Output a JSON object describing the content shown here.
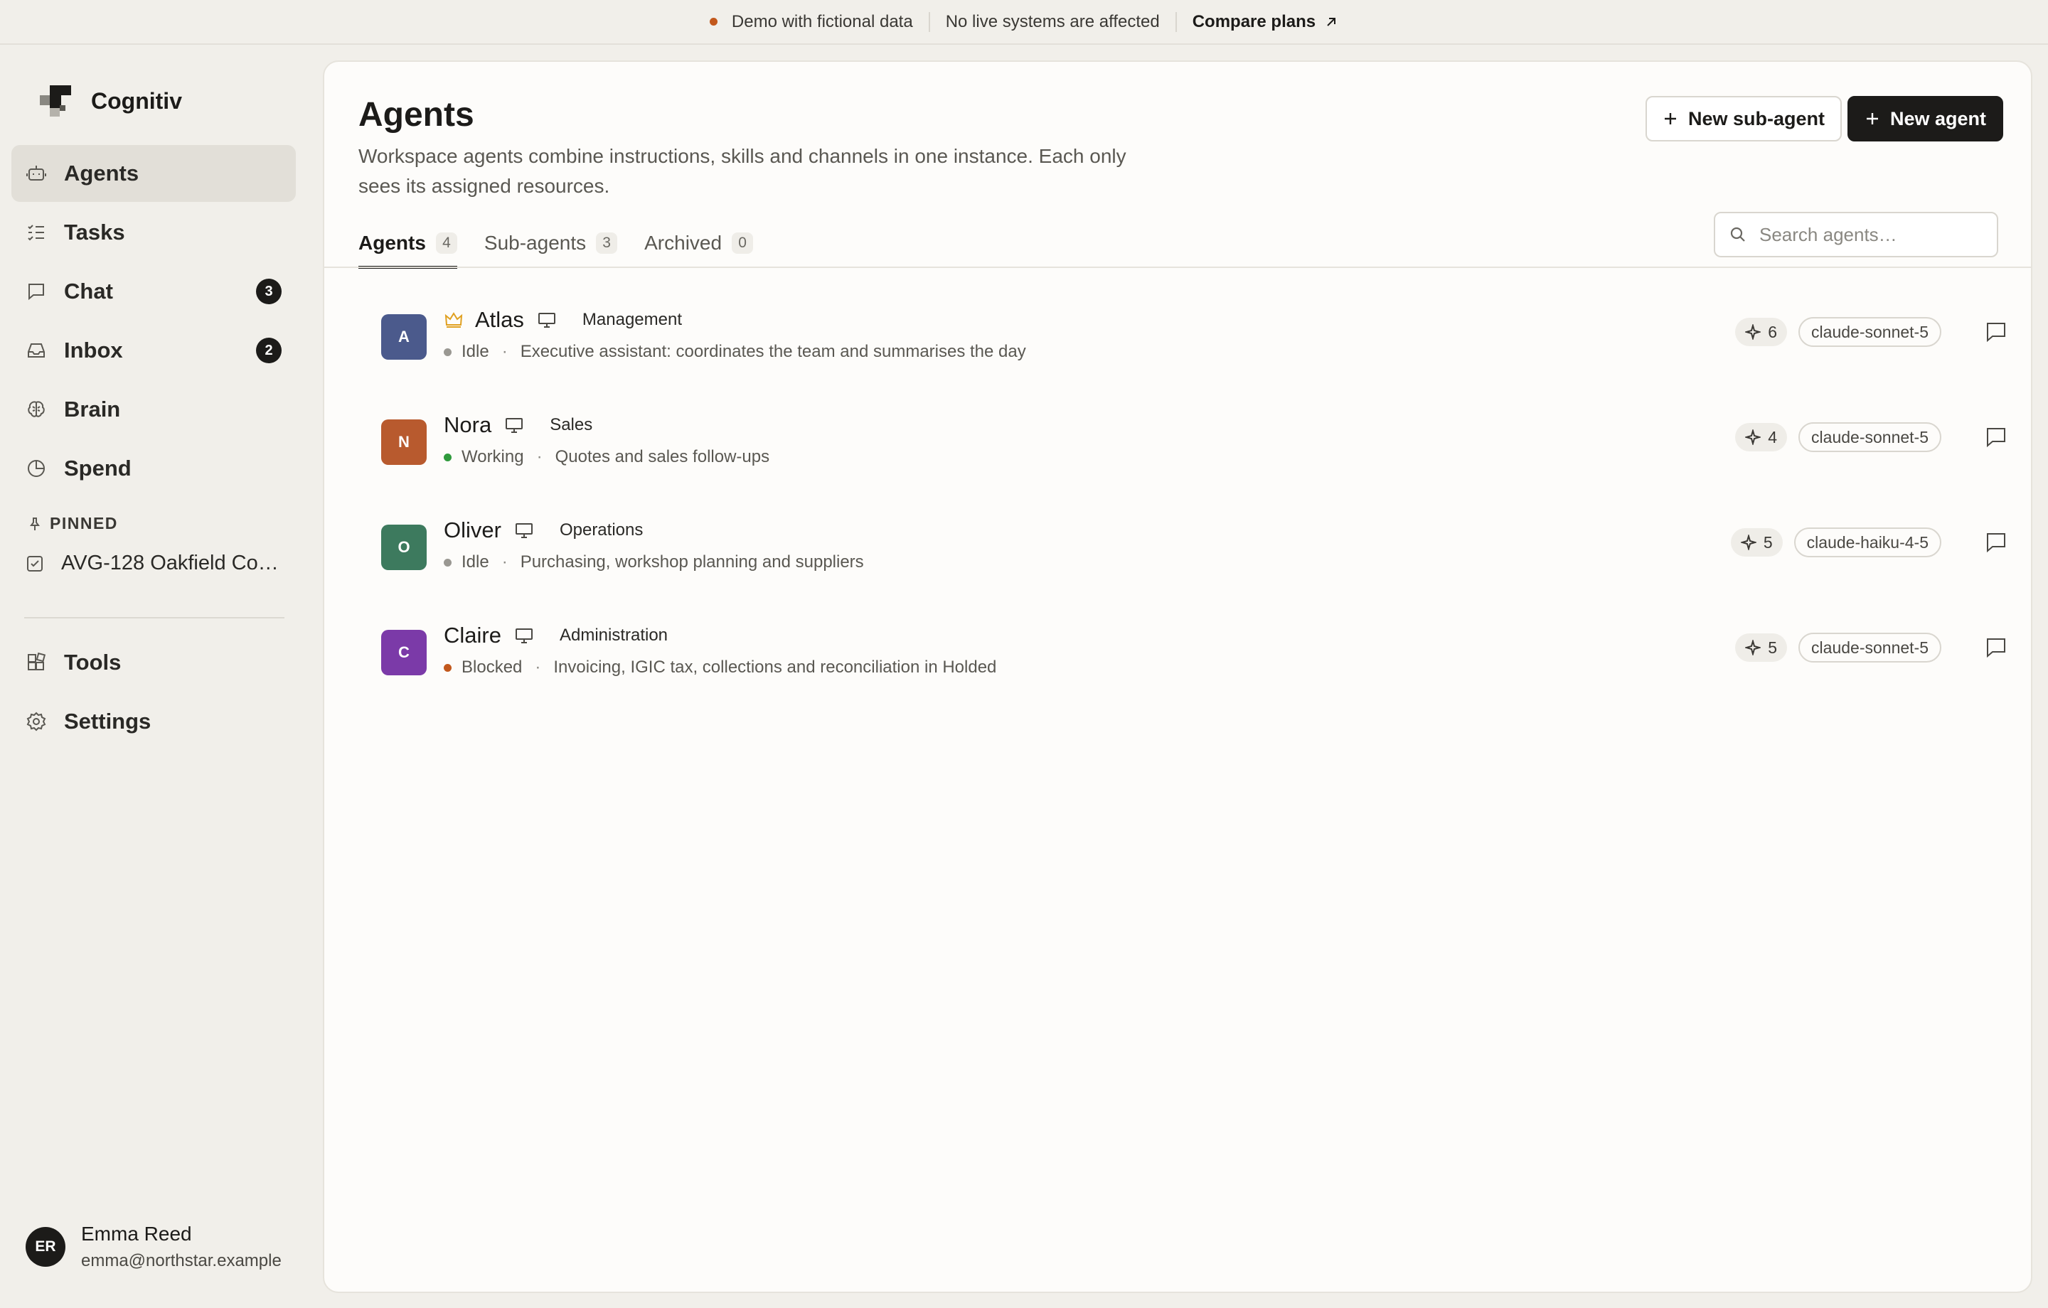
{
  "banner": {
    "demo": "Demo with fictional data",
    "no_live": "No live systems are affected",
    "compare": "Compare plans"
  },
  "brand": {
    "name": "Cognitiv"
  },
  "nav": {
    "agents": "Agents",
    "tasks": "Tasks",
    "chat": "Chat",
    "chat_badge": "3",
    "inbox": "Inbox",
    "inbox_badge": "2",
    "brain": "Brain",
    "spend": "Spend",
    "tools": "Tools",
    "settings": "Settings"
  },
  "pinned": {
    "label": "PINNED",
    "item": "AVG-128 Oakfield Co…"
  },
  "user": {
    "initials": "ER",
    "name": "Emma Reed",
    "email": "emma@northstar.example"
  },
  "page": {
    "title": "Agents",
    "subtitle": "Workspace agents combine instructions, skills and channels in one instance. Each only sees its assigned resources.",
    "new_sub_agent": "New sub-agent",
    "new_agent": "New agent",
    "search_placeholder": "Search agents…"
  },
  "tabs": [
    {
      "label": "Agents",
      "count": "4"
    },
    {
      "label": "Sub-agents",
      "count": "3"
    },
    {
      "label": "Archived",
      "count": "0"
    }
  ],
  "agents": [
    {
      "initial": "A",
      "name": "Atlas",
      "dept": "Management",
      "status": "Idle",
      "desc": "Executive assistant: coordinates the team and summarises the day",
      "skills": "6",
      "model": "claude-sonnet-5",
      "color": "#4b5a8c",
      "status_color": "#9a9892",
      "lead": true
    },
    {
      "initial": "N",
      "name": "Nora",
      "dept": "Sales",
      "status": "Working",
      "desc": "Quotes and sales follow-ups",
      "skills": "4",
      "model": "claude-sonnet-5",
      "color": "#b85a2e",
      "status_color": "#2f9a3c"
    },
    {
      "initial": "O",
      "name": "Oliver",
      "dept": "Operations",
      "status": "Idle",
      "desc": "Purchasing, workshop planning and suppliers",
      "skills": "5",
      "model": "claude-haiku-4-5",
      "color": "#3d7a5e",
      "status_color": "#9a9892"
    },
    {
      "initial": "C",
      "name": "Claire",
      "dept": "Administration",
      "status": "Blocked",
      "desc": "Invoicing, IGIC tax, collections and reconciliation in Holded",
      "skills": "5",
      "model": "claude-sonnet-5",
      "color": "#7b3aa8",
      "status_color": "#c2581c"
    }
  ]
}
